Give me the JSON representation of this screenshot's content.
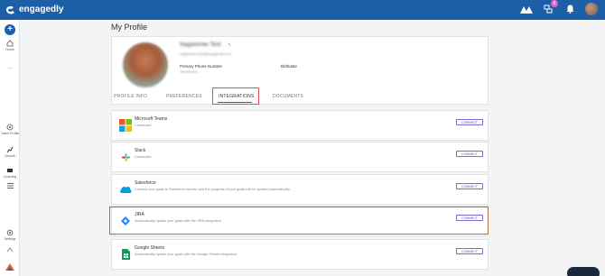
{
  "app": {
    "brand": "engagedly"
  },
  "header": {
    "notification_count": "6"
  },
  "sidebar": {
    "items": [
      {
        "label": "Home"
      },
      {
        "label": "..."
      },
      {
        "label": "Talent Profile"
      },
      {
        "label": "Growth"
      },
      {
        "label": "Coaching"
      },
      {
        "label": "Settings"
      }
    ]
  },
  "page": {
    "title": "My Profile"
  },
  "profile": {
    "name": "Nagashree Test",
    "email": "nagashree.test@engagedly.com",
    "phone_label": "Primary Phone Number",
    "phone_value": "9999999999",
    "birthdate_label": "Birthdate"
  },
  "tabs": [
    {
      "label": "PROFILE INFO",
      "active": false
    },
    {
      "label": "PREFERENCES",
      "active": false
    },
    {
      "label": "INTEGRATIONS",
      "active": true
    },
    {
      "label": "DOCUMENTS",
      "active": false
    }
  ],
  "integrations": [
    {
      "name": "Microsoft Teams",
      "desc": "Connected -",
      "button": "CONNECT",
      "icon": "microsoft-teams-icon"
    },
    {
      "name": "Slack",
      "desc": "Connected -",
      "button": "CONNECT",
      "icon": "slack-icon"
    },
    {
      "name": "Salesforce",
      "desc": "Connect your goals to Salesforce reports, and the progress of your goals will be updated automatically.",
      "button": "CONNECT",
      "icon": "salesforce-icon"
    },
    {
      "name": "JIRA",
      "desc": "Automatically update your goals with the JIRA integration.",
      "button": "CONNECT",
      "icon": "jira-icon"
    },
    {
      "name": "Google Sheets",
      "desc": "Automatically update your goals with the Google Sheets integration.",
      "button": "CONNECT",
      "icon": "google-sheets-icon"
    }
  ],
  "colors": {
    "primary": "#1d5fa7",
    "highlight_red": "#d9534f",
    "highlight_orange": "#b0712c",
    "connect": "#5a48c5"
  }
}
